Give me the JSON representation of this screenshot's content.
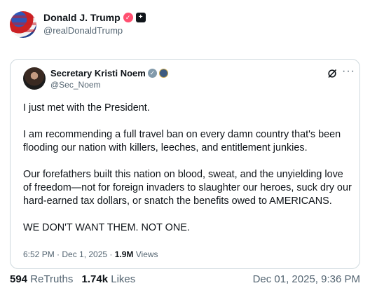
{
  "post": {
    "author": {
      "display_name": "Donald J. Trump",
      "handle": "@realDonaldTrump",
      "badges": [
        "pink-verified-icon",
        "truth-plus-icon"
      ]
    },
    "quoted": {
      "author": {
        "display_name": "Secretary Kristi Noem",
        "handle": "@Sec_Noem",
        "badges": [
          "gray-verified-icon",
          "government-seal-icon"
        ]
      },
      "paragraphs": [
        "I just met with the President.",
        "I am recommending a full travel ban on every damn country that's been flooding our nation with killers, leeches, and entitlement junkies.",
        "Our forefathers built this nation on blood, sweat, and the unyielding love of freedom—not for foreign invaders to slaughter our heroes, suck dry our hard-earned tax dollars, or snatch the benefits owed to AMERICANS.",
        "WE DON'T WANT THEM. NOT ONE."
      ],
      "meta": {
        "time_date": "6:52 PM · Dec 1, 2025 · ",
        "views_count": "1.9M",
        "views_label": " Views"
      },
      "actions": {
        "grok_icon": "grok-icon",
        "more_icon": "more-options-icon"
      }
    },
    "stats": {
      "retruths_count": "594",
      "retruths_label": "ReTruths",
      "likes_count": "1.74k",
      "likes_label": "Likes",
      "timestamp": "Dec 01, 2025, 9:36 PM"
    }
  }
}
